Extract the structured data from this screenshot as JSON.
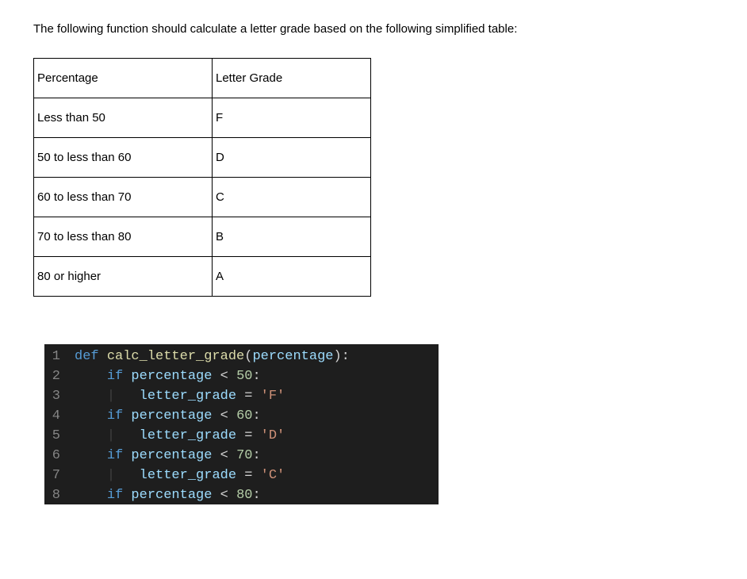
{
  "intro": "The following function should calculate a letter grade based on the following simplified table:",
  "table": {
    "headers": [
      "Percentage",
      "Letter Grade"
    ],
    "rows": [
      {
        "percentage": "Less than 50",
        "letter": "F"
      },
      {
        "percentage": "50 to less than 60",
        "letter": "D"
      },
      {
        "percentage": "60 to less than 70",
        "letter": "C"
      },
      {
        "percentage": "70 to less than 80",
        "letter": "B"
      },
      {
        "percentage": "80 or higher",
        "letter": "A"
      }
    ]
  },
  "code": {
    "lines": [
      {
        "n": "1",
        "tokens": [
          {
            "cls": "tok-keyword",
            "t": "def"
          },
          {
            "cls": "tok-punct",
            "t": " "
          },
          {
            "cls": "tok-func",
            "t": "calc_letter_grade"
          },
          {
            "cls": "tok-punct",
            "t": "("
          },
          {
            "cls": "tok-ident",
            "t": "percentage"
          },
          {
            "cls": "tok-punct",
            "t": "):"
          }
        ]
      },
      {
        "n": "2",
        "tokens": [
          {
            "cls": "tok-punct",
            "t": "    "
          },
          {
            "cls": "tok-keyword",
            "t": "if"
          },
          {
            "cls": "tok-punct",
            "t": " "
          },
          {
            "cls": "tok-ident",
            "t": "percentage"
          },
          {
            "cls": "tok-op",
            "t": " < "
          },
          {
            "cls": "tok-num",
            "t": "50"
          },
          {
            "cls": "tok-punct",
            "t": ":"
          }
        ]
      },
      {
        "n": "3",
        "tokens": [
          {
            "cls": "tok-punct",
            "t": "    "
          },
          {
            "cls": "indent-guide",
            "t": "|"
          },
          {
            "cls": "tok-punct",
            "t": "   "
          },
          {
            "cls": "tok-ident",
            "t": "letter_grade"
          },
          {
            "cls": "tok-op",
            "t": " = "
          },
          {
            "cls": "tok-str",
            "t": "'F'"
          }
        ]
      },
      {
        "n": "4",
        "tokens": [
          {
            "cls": "tok-punct",
            "t": "    "
          },
          {
            "cls": "tok-keyword",
            "t": "if"
          },
          {
            "cls": "tok-punct",
            "t": " "
          },
          {
            "cls": "tok-ident",
            "t": "percentage"
          },
          {
            "cls": "tok-op",
            "t": " < "
          },
          {
            "cls": "tok-num",
            "t": "60"
          },
          {
            "cls": "tok-punct",
            "t": ":"
          }
        ]
      },
      {
        "n": "5",
        "tokens": [
          {
            "cls": "tok-punct",
            "t": "    "
          },
          {
            "cls": "indent-guide",
            "t": "|"
          },
          {
            "cls": "tok-punct",
            "t": "   "
          },
          {
            "cls": "tok-ident",
            "t": "letter_grade"
          },
          {
            "cls": "tok-op",
            "t": " = "
          },
          {
            "cls": "tok-str",
            "t": "'D'"
          }
        ]
      },
      {
        "n": "6",
        "tokens": [
          {
            "cls": "tok-punct",
            "t": "    "
          },
          {
            "cls": "tok-keyword",
            "t": "if"
          },
          {
            "cls": "tok-punct",
            "t": " "
          },
          {
            "cls": "tok-ident",
            "t": "percentage"
          },
          {
            "cls": "tok-op",
            "t": " < "
          },
          {
            "cls": "tok-num",
            "t": "70"
          },
          {
            "cls": "tok-punct",
            "t": ":"
          }
        ]
      },
      {
        "n": "7",
        "tokens": [
          {
            "cls": "tok-punct",
            "t": "    "
          },
          {
            "cls": "indent-guide",
            "t": "|"
          },
          {
            "cls": "tok-punct",
            "t": "   "
          },
          {
            "cls": "tok-ident",
            "t": "letter_grade"
          },
          {
            "cls": "tok-op",
            "t": " = "
          },
          {
            "cls": "tok-str",
            "t": "'C'"
          }
        ]
      },
      {
        "n": "8",
        "tokens": [
          {
            "cls": "tok-punct",
            "t": "    "
          },
          {
            "cls": "tok-keyword",
            "t": "if"
          },
          {
            "cls": "tok-punct",
            "t": " "
          },
          {
            "cls": "tok-ident",
            "t": "percentage"
          },
          {
            "cls": "tok-op",
            "t": " < "
          },
          {
            "cls": "tok-num",
            "t": "80"
          },
          {
            "cls": "tok-punct",
            "t": ":"
          }
        ]
      }
    ]
  }
}
